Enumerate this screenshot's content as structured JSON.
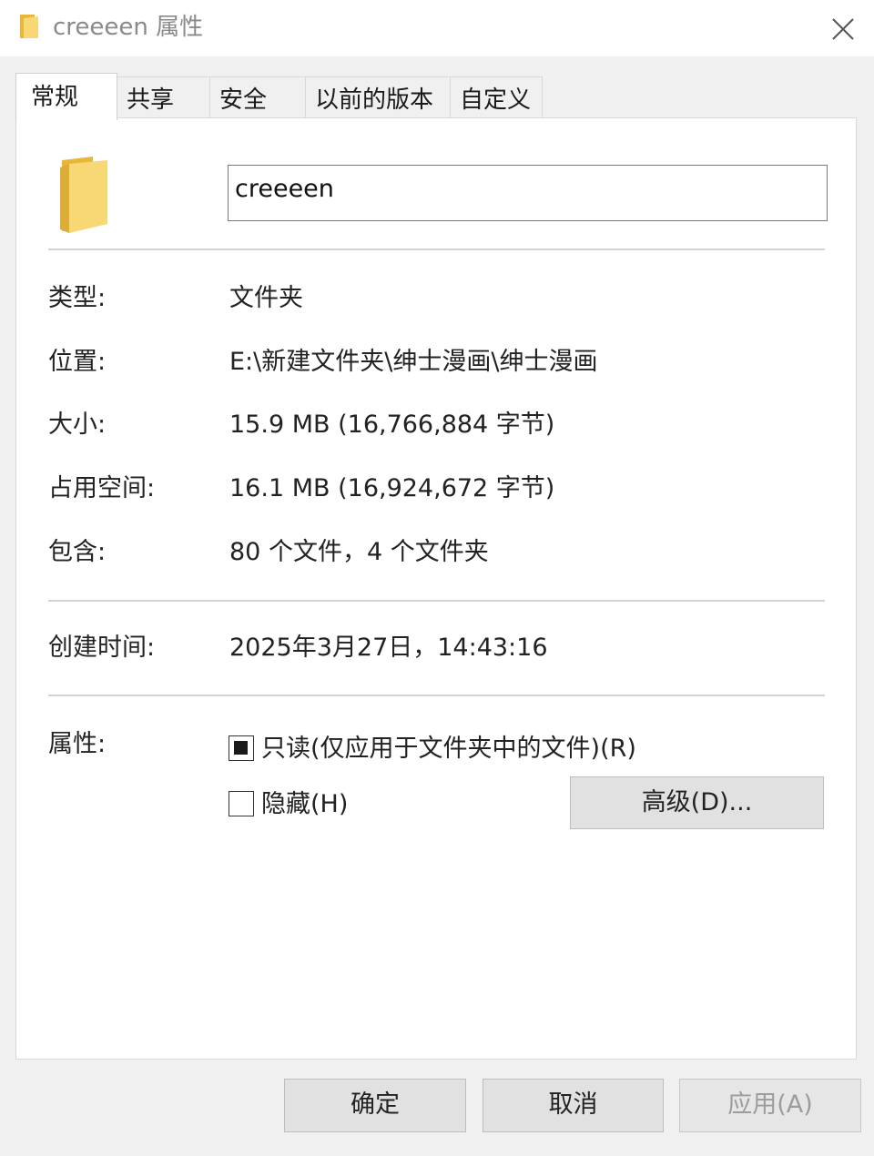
{
  "window": {
    "title": "creeeen 属性",
    "close_icon": "close-icon"
  },
  "tabs": [
    {
      "label": "常规",
      "active": true
    },
    {
      "label": "共享",
      "active": false
    },
    {
      "label": "安全",
      "active": false
    },
    {
      "label": "以前的版本",
      "active": false
    },
    {
      "label": "自定义",
      "active": false
    }
  ],
  "general": {
    "folder_icon": "folder-icon",
    "name_value": "creeeen",
    "type_label": "类型:",
    "type_value": "文件夹",
    "location_label": "位置:",
    "location_value": "E:\\新建文件夹\\绅士漫画\\绅士漫画",
    "size_label": "大小:",
    "size_value": "15.9 MB (16,766,884 字节)",
    "disk_size_label": "占用空间:",
    "disk_size_value": "16.1 MB (16,924,672 字节)",
    "contains_label": "包含:",
    "contains_value": "80 个文件，4 个文件夹",
    "created_label": "创建时间:",
    "created_value": "2025年3月27日，14:43:16",
    "attributes_label": "属性:",
    "readonly_label": "只读(仅应用于文件夹中的文件)(R)",
    "readonly_state": "indeterminate",
    "hidden_label": "隐藏(H)",
    "hidden_state": "unchecked",
    "advanced_button": "高级(D)..."
  },
  "footer": {
    "ok_button": "确定",
    "cancel_button": "取消",
    "apply_button": "应用(A)",
    "apply_disabled": true
  },
  "colors": {
    "folder_yellow": "#f8d775",
    "folder_dark": "#e8b73a",
    "window_bg": "#f0f0f0",
    "panel_bg": "#ffffff"
  }
}
